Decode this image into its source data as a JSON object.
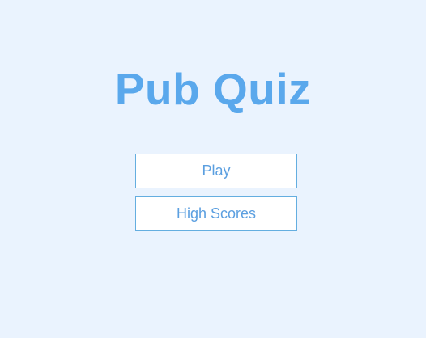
{
  "title": "Pub Quiz",
  "menu": {
    "play_label": "Play",
    "high_scores_label": "High Scores"
  },
  "colors": {
    "background": "#eaf3fe",
    "title": "#5aa8ec",
    "button_text": "#5b9fe0",
    "button_border": "#64aee0",
    "button_background": "#ffffff"
  }
}
